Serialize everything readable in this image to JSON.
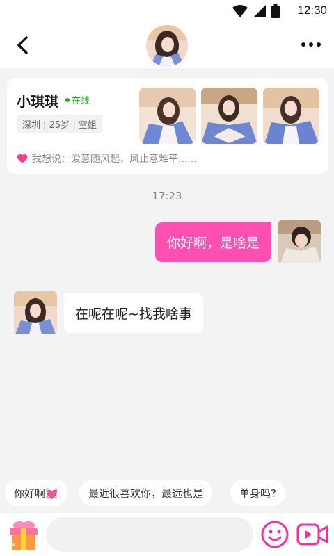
{
  "status_bar": {
    "time": "12:30"
  },
  "header": {
    "icons": [
      "back-arrow-icon",
      "more-dots-icon"
    ]
  },
  "profile_card": {
    "name": "小琪琪",
    "status": "在线",
    "tags": "深圳 | 25岁 | 空姐",
    "motto": "我想说：爱意随风起，风止意难平......",
    "colors": {
      "online": "#1aad19",
      "heart": "#ff3d8b"
    }
  },
  "chat": {
    "timestamp": "17:23",
    "messages": [
      {
        "side": "right",
        "text": "你好啊，是啥是"
      },
      {
        "side": "left",
        "text": "在呢在呢~找我啥事"
      }
    ],
    "colors": {
      "outgoing_bubble": "#ff4fb3",
      "incoming_bubble": "#ffffff"
    }
  },
  "quick_replies": [
    "你好啊💓",
    "最近很喜欢你，最远也是",
    "单身吗?"
  ],
  "input_bar": {
    "placeholder": "",
    "icons": [
      "gift-box-icon",
      "emoji-icon",
      "video-call-icon"
    ],
    "accent": "#ff2d9a"
  }
}
